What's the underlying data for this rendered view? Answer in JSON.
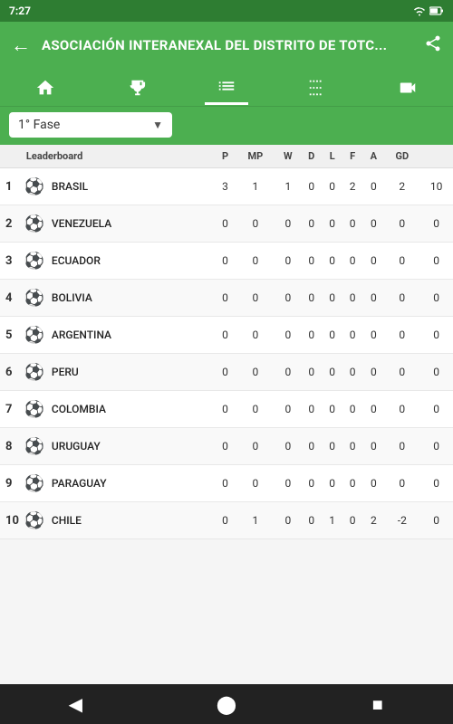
{
  "statusBar": {
    "time": "7:27",
    "icons": "signal wifi battery"
  },
  "topBar": {
    "backLabel": "←",
    "title": "ASOCIACIÓN INTERANEXAL DEL DISTRITO DE TOTC...",
    "shareIcon": "share"
  },
  "iconBar": {
    "items": [
      {
        "name": "home-icon",
        "label": "Home",
        "active": false
      },
      {
        "name": "trophy-icon",
        "label": "Trophy",
        "active": false
      },
      {
        "name": "list-icon",
        "label": "List",
        "active": true
      },
      {
        "name": "bracket-icon",
        "label": "Bracket",
        "active": false
      },
      {
        "name": "video-icon",
        "label": "Video",
        "active": false
      }
    ]
  },
  "dropdown": {
    "value": "1° Fase",
    "placeholder": "1° Fase"
  },
  "table": {
    "headers": [
      "",
      "Leaderboard",
      "P",
      "MP",
      "W",
      "D",
      "L",
      "F",
      "A",
      "GD",
      ""
    ],
    "rows": [
      {
        "rank": "1",
        "team": "BRASIL",
        "P": "3",
        "MP": "1",
        "W": "1",
        "D": "0",
        "L": "0",
        "F": "2",
        "A": "0",
        "GD": "2",
        "extra": "10",
        "highlight": false
      },
      {
        "rank": "2",
        "team": "VENEZUELA",
        "P": "0",
        "MP": "0",
        "W": "0",
        "D": "0",
        "L": "0",
        "F": "0",
        "A": "0",
        "GD": "0",
        "extra": "0",
        "highlight": false
      },
      {
        "rank": "3",
        "team": "ECUADOR",
        "P": "0",
        "MP": "0",
        "W": "0",
        "D": "0",
        "L": "0",
        "F": "0",
        "A": "0",
        "GD": "0",
        "extra": "0",
        "highlight": false
      },
      {
        "rank": "4",
        "team": "BOLIVIA",
        "P": "0",
        "MP": "0",
        "W": "0",
        "D": "0",
        "L": "0",
        "F": "0",
        "A": "0",
        "GD": "0",
        "extra": "0",
        "highlight": false
      },
      {
        "rank": "5",
        "team": "ARGENTINA",
        "P": "0",
        "MP": "0",
        "W": "0",
        "D": "0",
        "L": "0",
        "F": "0",
        "A": "0",
        "GD": "0",
        "extra": "0",
        "highlight": false
      },
      {
        "rank": "6",
        "team": "PERU",
        "P": "0",
        "MP": "0",
        "W": "0",
        "D": "0",
        "L": "0",
        "F": "0",
        "A": "0",
        "GD": "0",
        "extra": "0",
        "highlight": false
      },
      {
        "rank": "7",
        "team": "COLOMBIA",
        "P": "0",
        "MP": "0",
        "W": "0",
        "D": "0",
        "L": "0",
        "F": "0",
        "A": "0",
        "GD": "0",
        "extra": "0",
        "highlight": false
      },
      {
        "rank": "8",
        "team": "URUGUAY",
        "P": "0",
        "MP": "0",
        "W": "0",
        "D": "0",
        "L": "0",
        "F": "0",
        "A": "0",
        "GD": "0",
        "extra": "0",
        "highlight": false
      },
      {
        "rank": "9",
        "team": "PARAGUAY",
        "P": "0",
        "MP": "0",
        "W": "0",
        "D": "0",
        "L": "0",
        "F": "0",
        "A": "0",
        "GD": "0",
        "extra": "0",
        "highlight": false
      },
      {
        "rank": "10",
        "team": "CHILE",
        "P": "0",
        "MP": "1",
        "W": "0",
        "D": "0",
        "L": "1",
        "F": "0",
        "A": "2",
        "GD": "-2",
        "extra": "0",
        "highlight": false
      }
    ]
  },
  "bottomNav": {
    "back": "◀",
    "home": "⬤",
    "square": "■"
  }
}
